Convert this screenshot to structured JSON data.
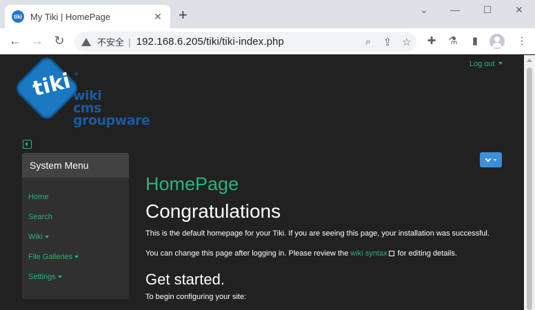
{
  "browser": {
    "tab_title": "My Tiki | HomePage",
    "favicon_text": "tiki",
    "new_tab_glyph": "+",
    "security_label": "不安全",
    "url": "192.168.6.205/tiki/tiki-index.php"
  },
  "page": {
    "logout_label": "Log out",
    "logo": {
      "word": "tiki",
      "tagline": [
        "wiki",
        "cms",
        "groupware"
      ]
    },
    "system_menu": {
      "title": "System Menu",
      "items": [
        {
          "label": "Home",
          "has_caret": false
        },
        {
          "label": "Search",
          "has_caret": false
        },
        {
          "label": "Wiki",
          "has_caret": true
        },
        {
          "label": "File Galleries",
          "has_caret": true
        },
        {
          "label": "Settings",
          "has_caret": true
        }
      ]
    },
    "title": "HomePage",
    "heading": "Congratulations",
    "para1": "This is the default homepage for your Tiki. If you are seeing this page, your installation was successful.",
    "para2_before": "You can change this page after logging in. Please review the ",
    "para2_link": "wiki syntax",
    "para2_after": " for editing details.",
    "subheading": "Get started.",
    "para3": "To begin configuring your site:"
  },
  "colors": {
    "accent_green": "#2ab27b",
    "logo_blue": "#1a78c2",
    "button_blue": "#3d8fd9",
    "background": "#212121"
  }
}
